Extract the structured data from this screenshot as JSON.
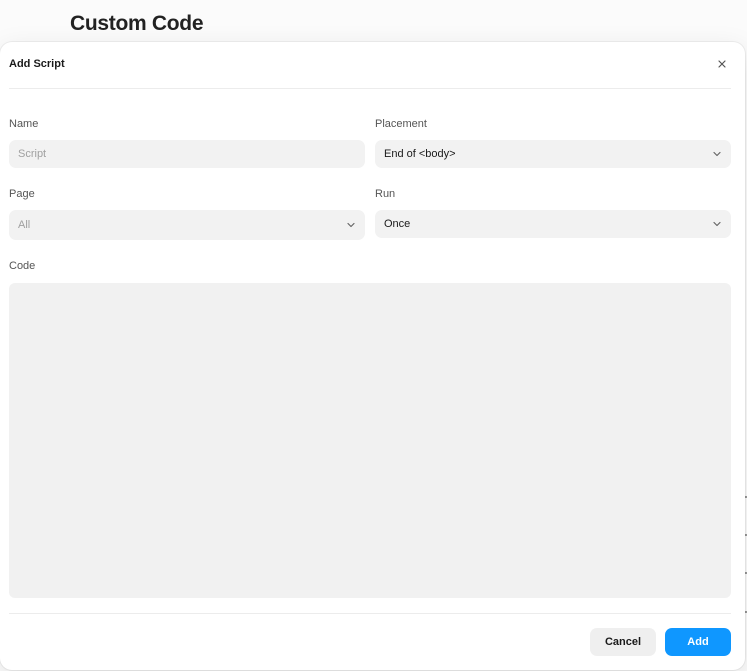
{
  "page": {
    "title": "Custom Code"
  },
  "modal": {
    "title": "Add Script",
    "close_icon": "close-icon",
    "fields": {
      "name": {
        "label": "Name",
        "placeholder": "Script",
        "value": ""
      },
      "placement": {
        "label": "Placement",
        "value": "End of <body>"
      },
      "page": {
        "label": "Page",
        "value": "All"
      },
      "run": {
        "label": "Run",
        "value": "Once"
      },
      "code": {
        "label": "Code",
        "value": ""
      }
    },
    "buttons": {
      "cancel": "Cancel",
      "add": "Add"
    }
  },
  "colors": {
    "accent": "#0f97ff",
    "field_bg": "#f2f2f2",
    "cancel_bg": "#efefef"
  }
}
